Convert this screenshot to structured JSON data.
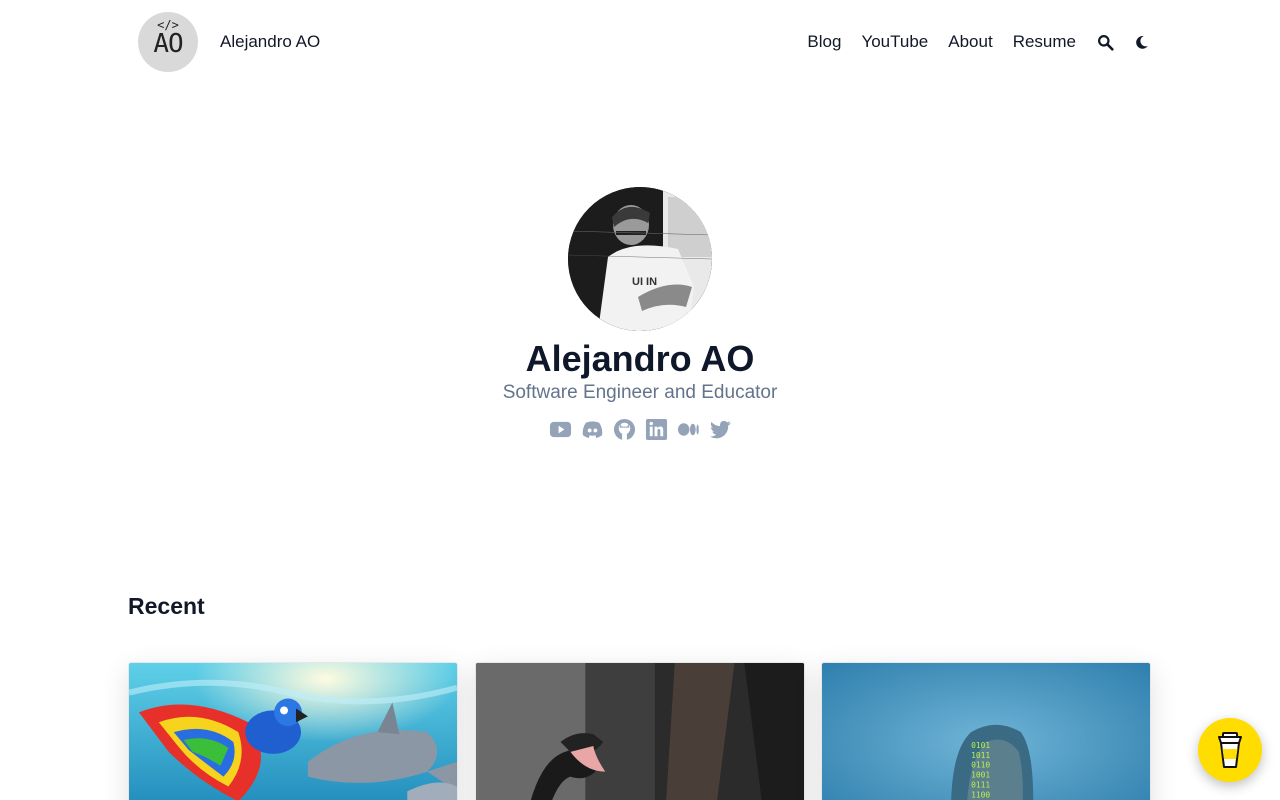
{
  "header": {
    "logo": {
      "tag": "</>",
      "letters": "AO"
    },
    "site_name": "Alejandro AO",
    "nav": [
      {
        "label": "Blog"
      },
      {
        "label": "YouTube"
      },
      {
        "label": "About"
      },
      {
        "label": "Resume"
      }
    ],
    "search_icon": "search-icon",
    "theme_icon": "moon-icon"
  },
  "profile": {
    "name": "Alejandro AO",
    "title": "Software Engineer and Educator",
    "socials": [
      "youtube-icon",
      "discord-icon",
      "github-icon",
      "linkedin-icon",
      "medium-icon",
      "twitter-icon"
    ]
  },
  "recent": {
    "heading": "Recent"
  },
  "colors": {
    "text": "#111827",
    "muted": "#64748b",
    "social": "#94a3b8",
    "coffee": "#ffdd00"
  }
}
